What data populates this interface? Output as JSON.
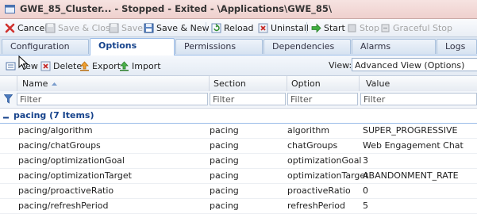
{
  "window": {
    "title": "GWE_85_Cluster... - Stopped - Exited - \\Applications\\GWE_85\\"
  },
  "toolbar": {
    "cancel": "Cancel",
    "save_close": "Save & Close",
    "save": "Save",
    "save_new": "Save & New",
    "reload": "Reload",
    "uninstall": "Uninstall",
    "start": "Start",
    "stop": "Stop",
    "graceful_stop": "Graceful Stop"
  },
  "tabs": [
    "Configuration",
    "Options",
    "Permissions",
    "Dependencies",
    "Alarms",
    "Logs"
  ],
  "active_tab": "Options",
  "grid_toolbar": {
    "view": "iew",
    "delete": "Delete",
    "export": "Export",
    "import": "Import",
    "view_label": "View:",
    "view_value": "Advanced View (Options)"
  },
  "columns": [
    "Name",
    "Section",
    "Option",
    "Value"
  ],
  "filter_placeholder": "Filter",
  "group": {
    "label": "pacing (7 Items)"
  },
  "rows": [
    {
      "name": "pacing/algorithm",
      "section": "pacing",
      "option": "algorithm",
      "value": "SUPER_PROGRESSIVE"
    },
    {
      "name": "pacing/chatGroups",
      "section": "pacing",
      "option": "chatGroups",
      "value": "Web Engagement Chat"
    },
    {
      "name": "pacing/optimizationGoal",
      "section": "pacing",
      "option": "optimizationGoal",
      "value": "3"
    },
    {
      "name": "pacing/optimizationTarget",
      "section": "pacing",
      "option": "optimizationTarget",
      "value": "ABANDONMENT_RATE"
    },
    {
      "name": "pacing/proactiveRatio",
      "section": "pacing",
      "option": "proactiveRatio",
      "value": "0"
    },
    {
      "name": "pacing/refreshPeriod",
      "section": "pacing",
      "option": "refreshPeriod",
      "value": "5"
    }
  ],
  "colors": {
    "title_bar": "#efd0cd",
    "accent": "#15428b",
    "grid_border": "#99bbe8"
  }
}
